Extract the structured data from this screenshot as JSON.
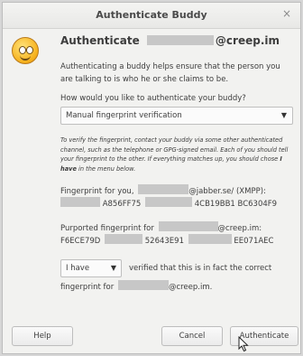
{
  "window": {
    "title": "Authenticate Buddy",
    "close_glyph": "×"
  },
  "header": {
    "word": "Authenticate",
    "domain": "@creep.im"
  },
  "intro": "Authenticating a buddy helps ensure that the person you are talking to is who he or she claims to be.",
  "question": "How would you like to authenticate your buddy?",
  "method_select": {
    "selected": "Manual fingerprint verification"
  },
  "help_text": {
    "part1": "To verify the fingerprint, contact your buddy via some other authenticated channel, such as the telephone or GPG-signed email.  Each of you should tell your fingerprint to the other. If everything matches up, you should chose",
    "emph": "I have",
    "part2": "in the menu below."
  },
  "own_fp": {
    "label": "Fingerprint for you,",
    "account": "@jabber.se/ (XMPP):",
    "seg1": "A856FF75",
    "seg2": "4CB19BB1 BC6304F9"
  },
  "buddy_fp": {
    "label": "Purported fingerprint for",
    "account": "@creep.im:",
    "seg1": "F6ECE79D",
    "seg2": "52643E91",
    "seg3": "EE071AEC"
  },
  "verify": {
    "selected": "I have",
    "rest": "verified that this is in fact the correct",
    "line2_prefix": "fingerprint for",
    "line2_domain": "@creep.im."
  },
  "buttons": {
    "help": "Help",
    "cancel": "Cancel",
    "authenticate": "Authenticate"
  }
}
